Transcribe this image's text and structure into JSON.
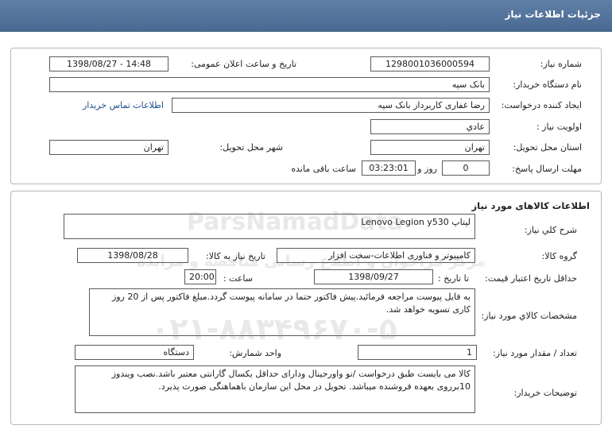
{
  "page": {
    "title": "جزئیات اطلاعات نیاز"
  },
  "need_info": {
    "need_number_label": "شماره نیاز:",
    "need_number": "1298001036000594",
    "announce_label": "تاریخ و ساعت اعلان عمومی:",
    "announce_value": "1398/08/27 - 14:48",
    "buyer_org_label": "نام دستگاه خریدار:",
    "buyer_org": "بانک سپه",
    "creator_label": "ایجاد کننده درخواست:",
    "creator": "رضا غفاری کاربرداز بانک سپه",
    "contact_link": "اطلاعات تماس خریدار",
    "priority_label": "اولویت نیاز :",
    "priority": "عادي",
    "province_label": "استان محل تحویل:",
    "province": "تهران",
    "city_label": "شهر محل تحویل:",
    "city": "تهران",
    "deadline_label": "مهلت ارسال پاسخ:",
    "deadline_days": "0",
    "day_and": "روز و",
    "deadline_time": "03:23:01",
    "remaining": "ساعت باقی مانده"
  },
  "goods": {
    "section_title": "اطلاعات کالاهای مورد نیاز",
    "summary_label": "شرح کلي نیاز:",
    "summary": "لپتاپ Lenovo Legion y530",
    "group_label": "گروه کالا:",
    "group": "کامپیوتر و فناوری اطلاعات-سخت افزار",
    "need_date_label": "تاریخ نیاز به کالا:",
    "need_date": "1398/08/28",
    "validity_label": "حداقل تاریخ اعتبار قیمت:",
    "until_label": "تا تاریخ :",
    "validity_date": "1398/09/27",
    "hour_label": "ساعت :",
    "validity_time": "20:00",
    "specs_label": "مشخصات کالاي مورد نیاز:",
    "specs": "به فایل پیوست مراجعه فرمائید.پیش فاکتور حتما در سامانه پیوست گردد.مبلغ فاکتور پس از 20 روز کاری تسویه خواهد شد.",
    "qty_label": "تعداد / مقدار مورد نیاز:",
    "qty": "1",
    "unit_label": "واحد شمارش:",
    "unit": "دستگاه",
    "buyer_notes_label": "توضیحات خریدار:",
    "buyer_notes": "کالا می بایست طبق درخواست /نو واورجینال ودارای حداقل یکسال گارانتی معتبر باشد.نصب ویندوز 10برروی بعهده فروشنده میباشد. تحویل در محل این سازمان باهماهنگی صورت پذیرد."
  },
  "watermark": {
    "brand": "ParsNamadData",
    "line1": "مرکز فراخوان و اطلاع رسانی مناقصه و مزایده",
    "line2": "۰۲۱-۸۸۳۴۹۶۷۰-۵"
  }
}
